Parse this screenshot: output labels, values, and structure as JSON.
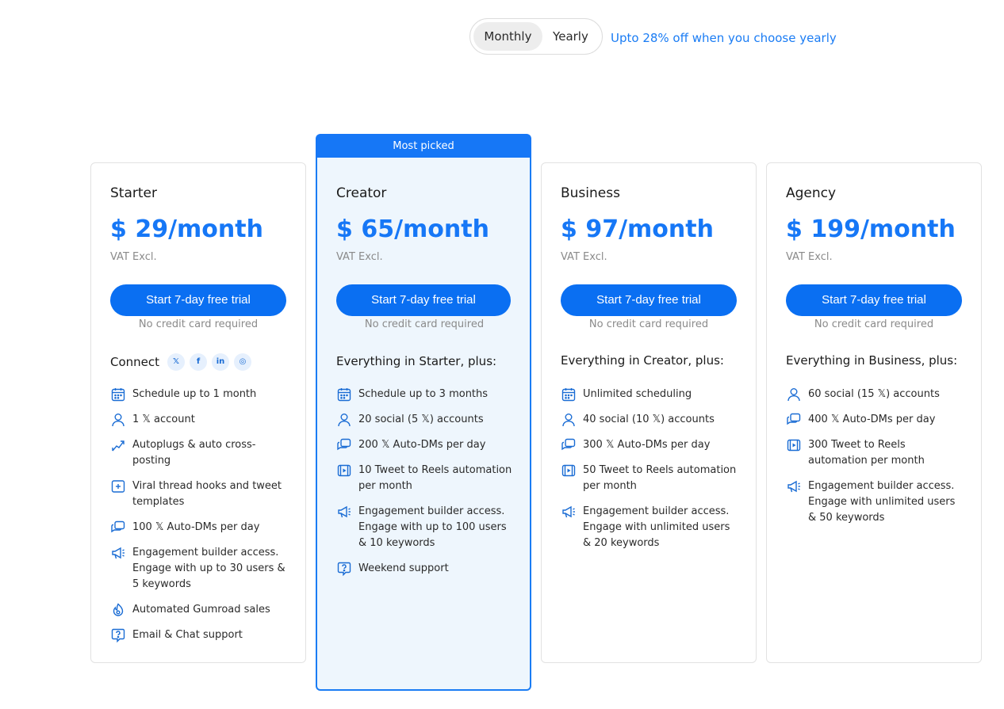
{
  "billing": {
    "monthly_label": "Monthly",
    "yearly_label": "Yearly",
    "discount_note": "Upto 28% off when you choose yearly"
  },
  "highlight_badge": "Most picked",
  "colors": {
    "accent": "#1677f6",
    "button": "#0a6ff2",
    "highlight_bg": "#eef6fd"
  },
  "plans": [
    {
      "name": "Starter",
      "price": "$ 29/month",
      "vat": "VAT Excl.",
      "cta": "Start 7-day free trial",
      "cta_note": "No credit card required",
      "section_head": "Connect",
      "social": [
        "x-icon",
        "facebook-icon",
        "linkedin-icon",
        "instagram-icon"
      ],
      "features": [
        {
          "icon": "calendar-icon",
          "text": "Schedule up to 1 month"
        },
        {
          "icon": "user-icon",
          "text": "1 𝕏 account"
        },
        {
          "icon": "trend-up-icon",
          "text": "Autoplugs & auto cross-posting"
        },
        {
          "icon": "template-icon",
          "text": "Viral thread hooks and tweet templates"
        },
        {
          "icon": "chat-icon",
          "text": "100 𝕏 Auto-DMs per day"
        },
        {
          "icon": "megaphone-icon",
          "text": "Engagement builder access. Engage with up to 30 users & 5 keywords"
        },
        {
          "icon": "gumroad-icon",
          "text": "Automated Gumroad sales"
        },
        {
          "icon": "help-icon",
          "text": "Email & Chat support"
        }
      ]
    },
    {
      "name": "Creator",
      "price": "$ 65/month",
      "vat": "VAT Excl.",
      "cta": "Start 7-day free trial",
      "cta_note": "No credit card required",
      "section_head": "Everything in Starter, plus:",
      "features": [
        {
          "icon": "calendar-icon",
          "text": "Schedule up to 3 months"
        },
        {
          "icon": "user-icon",
          "text": "20 social (5 𝕏) accounts"
        },
        {
          "icon": "chat-icon",
          "text": "200 𝕏 Auto-DMs per day"
        },
        {
          "icon": "reels-icon",
          "text": "10 Tweet to Reels automation per month"
        },
        {
          "icon": "megaphone-icon",
          "text": "Engagement builder access. Engage with up to 100 users & 10 keywords"
        },
        {
          "icon": "help-icon",
          "text": "Weekend support"
        }
      ]
    },
    {
      "name": "Business",
      "price": "$ 97/month",
      "vat": "VAT Excl.",
      "cta": "Start 7-day free trial",
      "cta_note": "No credit card required",
      "section_head": "Everything in Creator, plus:",
      "features": [
        {
          "icon": "calendar-icon",
          "text": "Unlimited scheduling"
        },
        {
          "icon": "user-icon",
          "text": "40 social (10 𝕏) accounts"
        },
        {
          "icon": "chat-icon",
          "text": "300 𝕏 Auto-DMs per day"
        },
        {
          "icon": "reels-icon",
          "text": "50 Tweet to Reels automation per month"
        },
        {
          "icon": "megaphone-icon",
          "text": "Engagement builder access. Engage with unlimited users & 20 keywords"
        }
      ]
    },
    {
      "name": "Agency",
      "price": "$ 199/month",
      "vat": "VAT Excl.",
      "cta": "Start 7-day free trial",
      "cta_note": "No credit card required",
      "section_head": "Everything in Business, plus:",
      "features": [
        {
          "icon": "user-icon",
          "text": "60 social (15 𝕏) accounts"
        },
        {
          "icon": "chat-icon",
          "text": "400 𝕏 Auto-DMs per day"
        },
        {
          "icon": "reels-icon",
          "text": "300 Tweet to Reels automation per month"
        },
        {
          "icon": "megaphone-icon",
          "text": "Engagement builder access. Engage with unlimited users & 50 keywords"
        }
      ]
    }
  ]
}
